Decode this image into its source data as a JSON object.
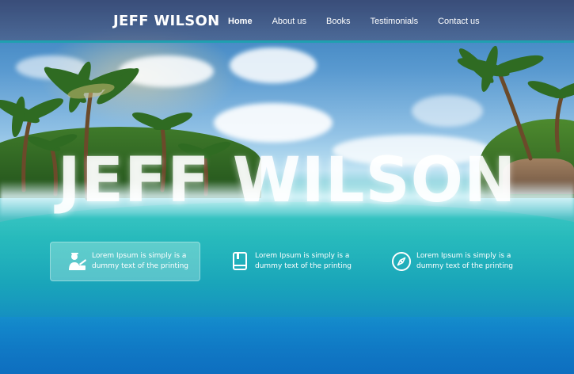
{
  "header": {
    "brand": "JEFF WILSON",
    "nav": [
      "Home",
      "About us",
      "Books",
      "Testimonials",
      "Contact us"
    ],
    "active_index": 0
  },
  "hero": {
    "title": "JEFF WILSON"
  },
  "features": [
    {
      "icon": "teacher-icon",
      "text": "Lorem Ipsum is simply is a dummy text of the printing"
    },
    {
      "icon": "book-icon",
      "text": "Lorem Ipsum is simply is a dummy text of the printing"
    },
    {
      "icon": "compass-icon",
      "text": "Lorem Ipsum is simply is a dummy text of the printing"
    }
  ],
  "colors": {
    "header_bg": "#4a5580",
    "header_accent": "#1fa0b0",
    "text": "#ffffff"
  }
}
